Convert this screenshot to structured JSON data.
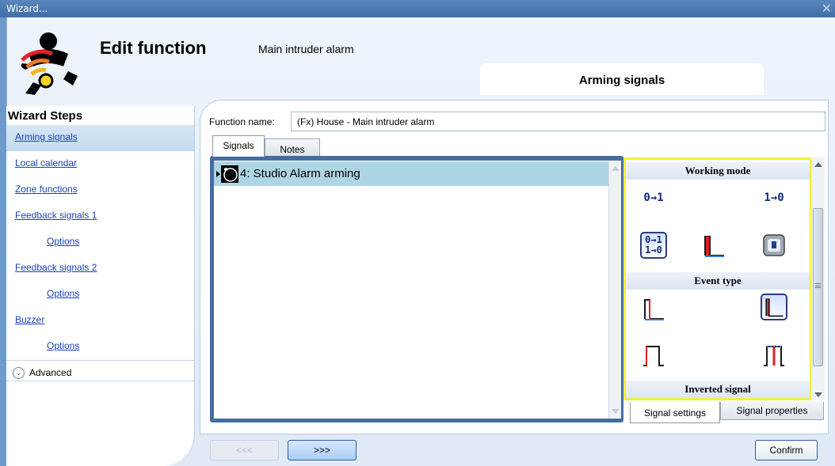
{
  "window": {
    "title": "Wizard...",
    "close_glyph": "✕"
  },
  "header": {
    "title": "Edit function",
    "subtitle": "Main intruder alarm",
    "current_step": "Arming signals",
    "logo_icon": "intruder-alarm-logo"
  },
  "sidebar": {
    "heading": "Wizard Steps",
    "items": [
      {
        "label": "Arming signals",
        "active": true
      },
      {
        "label": "Local calendar"
      },
      {
        "label": "Zone functions"
      },
      {
        "label": "Feedback signals 1"
      },
      {
        "label": "Options",
        "indent": true
      },
      {
        "label": "Feedback signals 2"
      },
      {
        "label": "Options",
        "indent": true
      },
      {
        "label": "Buzzer"
      },
      {
        "label": "Options",
        "indent": true
      }
    ],
    "advanced_label": "Advanced"
  },
  "function_name": {
    "label": "Function name:",
    "value": "(Fx) House - Main intruder alarm"
  },
  "tabs": {
    "signals": "Signals",
    "notes": "Notes"
  },
  "signal_list": [
    {
      "label": "4: Studio Alarm arming",
      "selected": true
    }
  ],
  "settings": {
    "working_mode_title": "Working mode",
    "event_type_title": "Event type",
    "inverted_signal_title": "Inverted signal",
    "working_mode_buttons": {
      "off_to_on": "0→1",
      "on_to_off": "1→0",
      "both_top": "0→1",
      "both_bottom": "1→0"
    }
  },
  "bottom_tabs": {
    "signal_settings": "Signal settings",
    "signal_properties": "Signal properties"
  },
  "buttons": {
    "back": "<<<",
    "next": ">>>",
    "confirm": "Confirm"
  },
  "colors": {
    "highlight_border": "#f3ef3e",
    "selected_row": "#add5e3",
    "link": "#1a3fb8"
  }
}
